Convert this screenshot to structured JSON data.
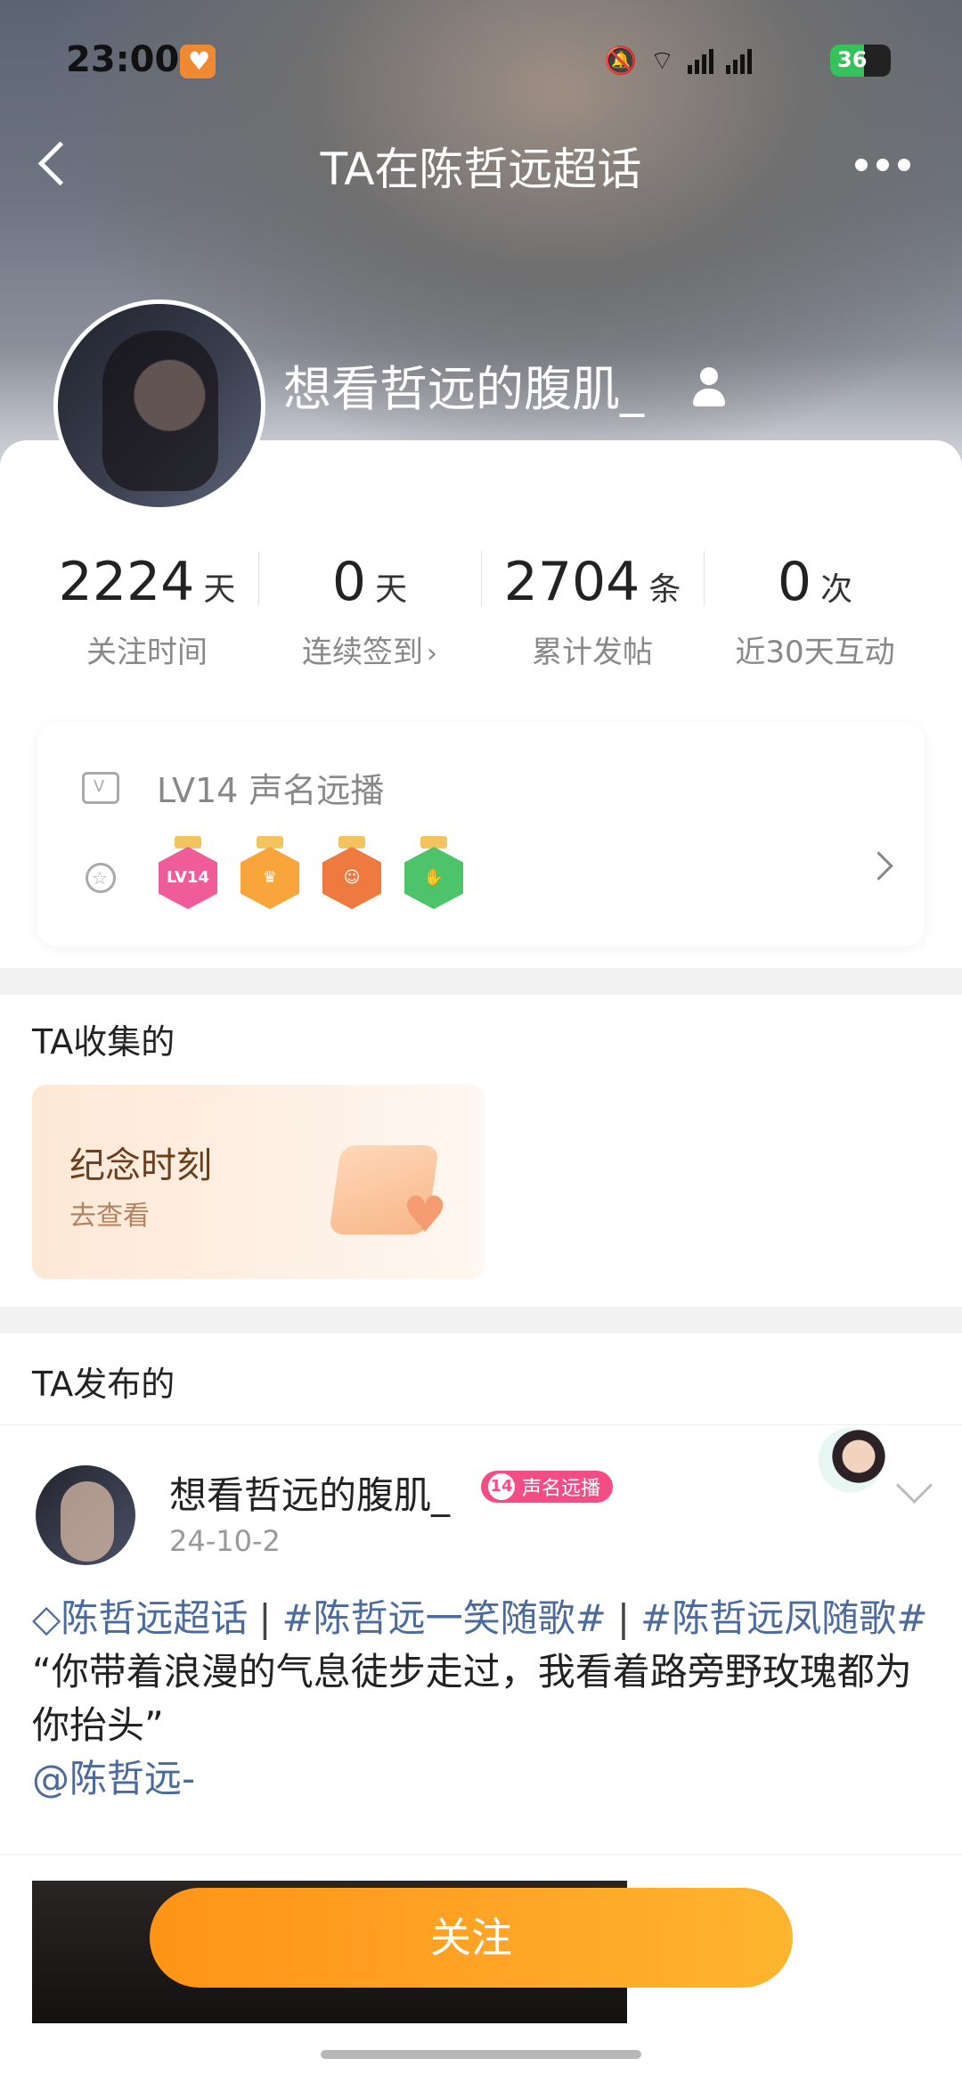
{
  "status_bar": {
    "time": "23:00",
    "battery": "36"
  },
  "nav": {
    "title": "TA在陈哲远超话"
  },
  "profile": {
    "username": "想看哲远的腹肌_"
  },
  "stats": [
    {
      "value": "2224",
      "unit": "天",
      "label": "关注时间",
      "has_arrow": false
    },
    {
      "value": "0",
      "unit": "天",
      "label": "连续签到",
      "has_arrow": true
    },
    {
      "value": "2704",
      "unit": "条",
      "label": "累计发帖",
      "has_arrow": false
    },
    {
      "value": "0",
      "unit": "次",
      "label": "近30天互动",
      "has_arrow": false
    }
  ],
  "level": {
    "text": "LV14 声名远播",
    "badges": [
      {
        "label": "LV14",
        "color": "#f05c9a",
        "ribbon": "#f3c35d"
      },
      {
        "label": "♛",
        "color": "#f8a53b",
        "ribbon": "#f3c35d"
      },
      {
        "label": "☺",
        "color": "#ee7a3f",
        "ribbon": "#f3c35d"
      },
      {
        "label": "✋",
        "color": "#4ec46a",
        "ribbon": "#f3c35d"
      }
    ]
  },
  "collected": {
    "title": "TA收集的",
    "card_title": "纪念时刻",
    "card_sub": "去查看"
  },
  "posted": {
    "title": "TA发布的",
    "user": "想看哲远的腹肌_",
    "level_num": "14",
    "level_name": "声名远播",
    "date": "24-10-2",
    "topic_super": "陈哲远超话",
    "topic_1": "#陈哲远一笑随歌#",
    "topic_2": "#陈哲远凤随歌#",
    "text": "“你带着浪漫的气息徒步走过，我看着路旁野玫瑰都为你抬头”",
    "mention": "@陈哲远-"
  },
  "follow_button": "关注",
  "colors": {
    "accent": "#ff9b1d",
    "link": "#4a6b9c",
    "level_tag": "#f44d86"
  }
}
